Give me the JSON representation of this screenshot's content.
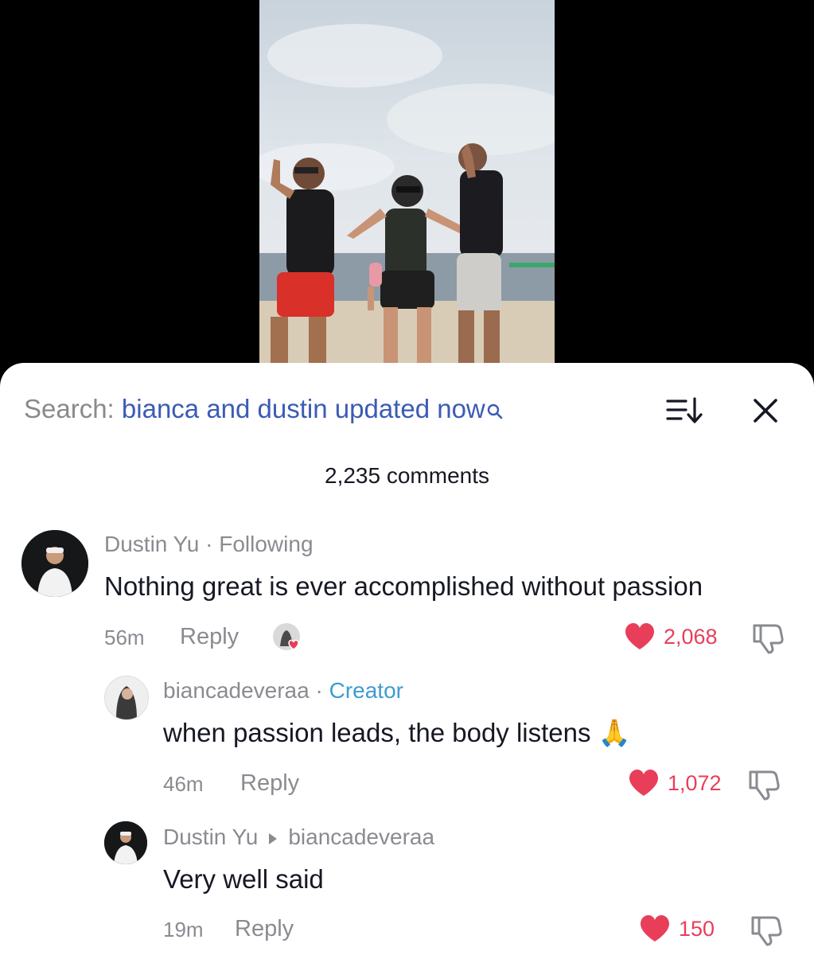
{
  "search": {
    "prefix": "Search: ",
    "query": "bianca and dustin updated now"
  },
  "header": {
    "comment_count": "2,235 comments"
  },
  "comments": [
    {
      "username": "Dustin Yu",
      "separator": " · ",
      "tag": "Following",
      "text": "Nothing great is ever accomplished without passion",
      "time": "56m",
      "reply_label": "Reply",
      "likes": "2,068",
      "creator_liked": true
    },
    {
      "username": "biancadeveraa",
      "separator": " · ",
      "tag": "Creator",
      "text": "when passion leads, the body listens 🙏",
      "time": "46m",
      "reply_label": "Reply",
      "likes": "1,072"
    },
    {
      "username": "Dustin Yu",
      "reply_to": "biancadeveraa",
      "text": "Very well said",
      "time": "19m",
      "reply_label": "Reply",
      "likes": "150"
    }
  ],
  "colors": {
    "accent_link": "#3b5bb5",
    "creator": "#3d9ccf",
    "like": "#e83e5a",
    "muted": "#8a8b91"
  },
  "icons": [
    "search-icon",
    "sort-icon",
    "close-icon",
    "heart-icon",
    "dislike-icon"
  ]
}
